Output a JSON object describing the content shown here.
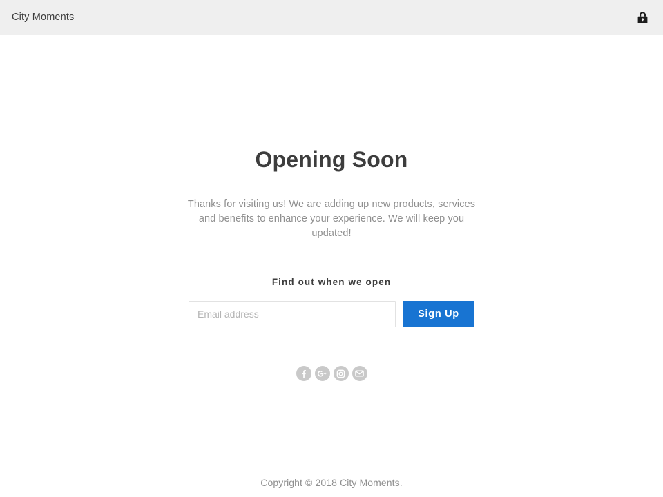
{
  "header": {
    "brand": "City Moments",
    "lock_icon": "lock-icon"
  },
  "main": {
    "headline": "Opening Soon",
    "lede": "Thanks for visiting us! We are adding up new products, services and benefits to enhance your experience. We will keep you updated!",
    "signup_label": "Find out when we open",
    "email_placeholder": "Email address",
    "email_value": "",
    "signup_button": "Sign Up",
    "social": [
      {
        "name": "facebook-icon",
        "label": "f"
      },
      {
        "name": "google-plus-icon",
        "label": "G+"
      },
      {
        "name": "instagram-icon",
        "label": ""
      },
      {
        "name": "email-icon",
        "label": ""
      }
    ]
  },
  "footer": {
    "copyright": "Copyright © 2018 City Moments."
  },
  "colors": {
    "header_bg": "#efefef",
    "accent_blue": "#1874d2",
    "heading": "#3d3d3d",
    "muted_text": "#8f8f8f",
    "social_circle": "#c9c9c9"
  }
}
